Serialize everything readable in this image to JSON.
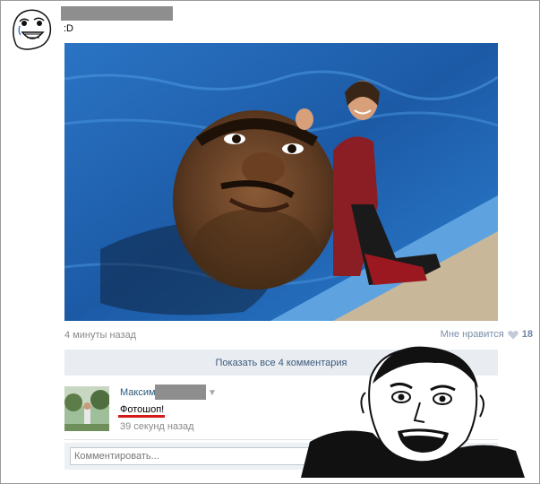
{
  "post": {
    "text": ":D",
    "time": "4 минуты назад",
    "like_label": "Мне нравится",
    "like_count": "18",
    "like_icon": "heart-icon",
    "photo_icon": "photo"
  },
  "comments": {
    "show_all_label": "Показать все 4 комментария",
    "items": [
      {
        "author": "Максим",
        "text": "Фотошоп!",
        "time": "39 секунд назад"
      }
    ]
  },
  "comment_form": {
    "placeholder": "Комментировать..."
  },
  "colors": {
    "link": "#2b587a",
    "muted": "#8a8a8a",
    "panel": "#e9edf1",
    "highlight": "#d21a1a"
  }
}
